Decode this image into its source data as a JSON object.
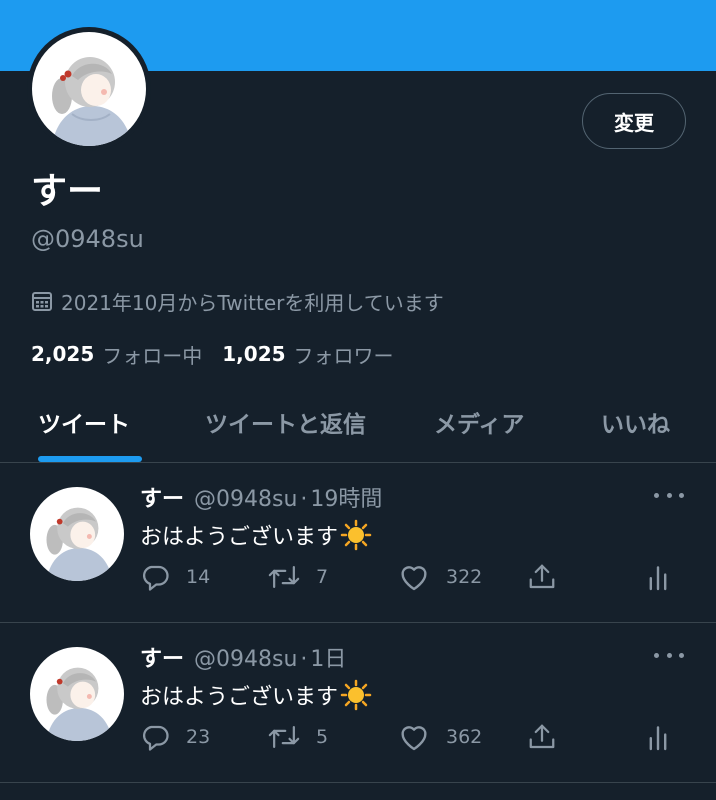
{
  "profile": {
    "display_name": "すー",
    "handle": "@0948su",
    "joined": "2021年10月からTwitterを利用しています",
    "change_button": "変更",
    "following_count": "2,025",
    "following_label": "フォロー中",
    "followers_count": "1,025",
    "followers_label": "フォロワー"
  },
  "tabs": [
    {
      "label": "ツイート",
      "active": true
    },
    {
      "label": "ツイートと返信",
      "active": false
    },
    {
      "label": "メディア",
      "active": false
    },
    {
      "label": "いいね",
      "active": false
    }
  ],
  "tweets": [
    {
      "name": "すー",
      "handle": "@0948su",
      "dot": "·",
      "time": "19時間",
      "text": "おはようございます",
      "replies": "14",
      "retweets": "7",
      "likes": "322"
    },
    {
      "name": "すー",
      "handle": "@0948su",
      "dot": "·",
      "time": "1日",
      "text": "おはようございます",
      "replies": "23",
      "retweets": "5",
      "likes": "362"
    }
  ],
  "colors": {
    "accent": "#1d9bf0",
    "background": "#15202b",
    "muted": "#8b98a5",
    "border": "#38444d"
  },
  "icons": [
    "calendar-icon",
    "sun-emoji-icon",
    "reply-icon",
    "retweet-icon",
    "like-icon",
    "share-icon",
    "analytics-icon",
    "more-icon"
  ]
}
